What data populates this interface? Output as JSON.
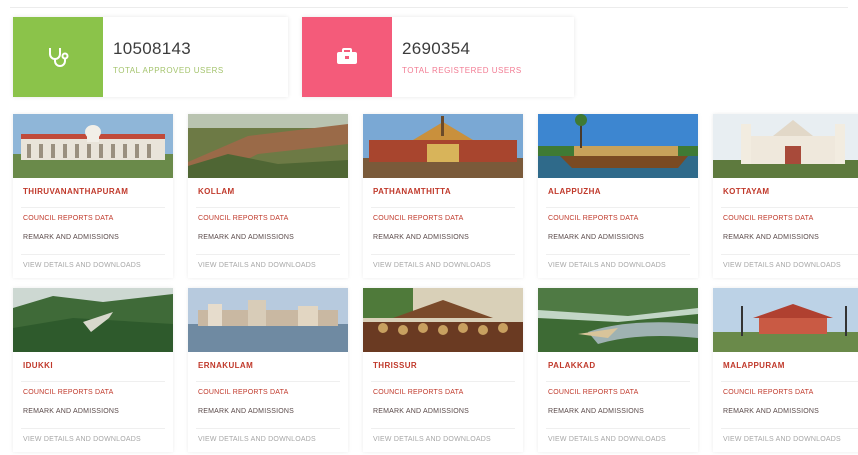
{
  "stats": [
    {
      "value": "10508143",
      "label": "TOTAL APPROVED USERS",
      "icon": "stethoscope-icon",
      "color": "#8bc34a"
    },
    {
      "value": "2690354",
      "label": "TOTAL REGISTERED USERS",
      "icon": "briefcase-icon",
      "color": "#f45b7a"
    }
  ],
  "districts": [
    {
      "name": "THIRUVANANTHAPURAM",
      "line1": "COUNCIL REPORTS DATA",
      "line2": "REMARK AND ADMISSIONS",
      "line3": "VIEW DETAILS AND DOWNLOADS"
    },
    {
      "name": "KOLLAM",
      "line1": "COUNCIL REPORTS DATA",
      "line2": "REMARK AND ADMISSIONS",
      "line3": "VIEW DETAILS AND DOWNLOADS"
    },
    {
      "name": "PATHANAMTHITTA",
      "line1": "COUNCIL REPORTS DATA",
      "line2": "REMARK AND ADMISSIONS",
      "line3": "VIEW DETAILS AND DOWNLOADS"
    },
    {
      "name": "ALAPPUZHA",
      "line1": "COUNCIL REPORTS DATA",
      "line2": "REMARK AND ADMISSIONS",
      "line3": "VIEW DETAILS AND DOWNLOADS"
    },
    {
      "name": "KOTTAYAM",
      "line1": "COUNCIL REPORTS DATA",
      "line2": "REMARK AND ADMISSIONS",
      "line3": "VIEW DETAILS AND DOWNLOADS"
    },
    {
      "name": "IDUKKI",
      "line1": "COUNCIL REPORTS DATA",
      "line2": "REMARK AND ADMISSIONS",
      "line3": "VIEW DETAILS AND DOWNLOADS"
    },
    {
      "name": "ERNAKULAM",
      "line1": "COUNCIL REPORTS DATA",
      "line2": "REMARK AND ADMISSIONS",
      "line3": "VIEW DETAILS AND DOWNLOADS"
    },
    {
      "name": "THRISSUR",
      "line1": "COUNCIL REPORTS DATA",
      "line2": "REMARK AND ADMISSIONS",
      "line3": "VIEW DETAILS AND DOWNLOADS"
    },
    {
      "name": "PALAKKAD",
      "line1": "COUNCIL REPORTS DATA",
      "line2": "REMARK AND ADMISSIONS",
      "line3": "VIEW DETAILS AND DOWNLOADS"
    },
    {
      "name": "MALAPPURAM",
      "line1": "COUNCIL REPORTS DATA",
      "line2": "REMARK AND ADMISSIONS",
      "line3": "VIEW DETAILS AND DOWNLOADS"
    }
  ],
  "accent": "#c0392b"
}
